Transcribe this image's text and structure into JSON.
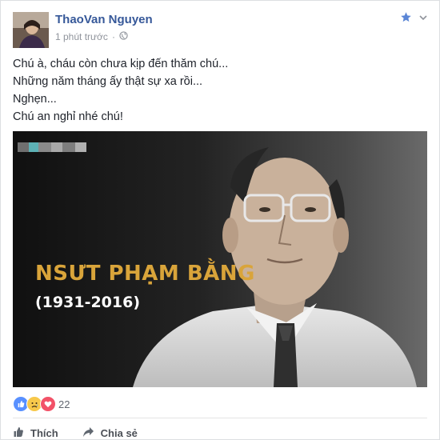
{
  "post": {
    "author": "ThaoVan Nguyen",
    "time": "1 phút trước",
    "separator": "·",
    "lines": [
      "Chú à, cháu còn chưa kịp đến thăm chú...",
      "Những năm tháng ấy thật sự xa rồi...",
      "Nghẹn...",
      "Chú an nghỉ nhé chú!"
    ]
  },
  "image": {
    "title": "NSƯT PHẠM BẰNG",
    "years": "(1931-2016)"
  },
  "reactions": {
    "count": "22",
    "icons": [
      "like-icon",
      "sad-icon",
      "love-icon"
    ]
  },
  "actions": {
    "like_label": "Thích",
    "share_label": "Chia sẻ"
  },
  "colors": {
    "link": "#365899",
    "title_gold": "#d9a43a",
    "like_blue": "#5890ff",
    "love_red": "#f25268",
    "sad_yellow": "#f7c84a"
  }
}
